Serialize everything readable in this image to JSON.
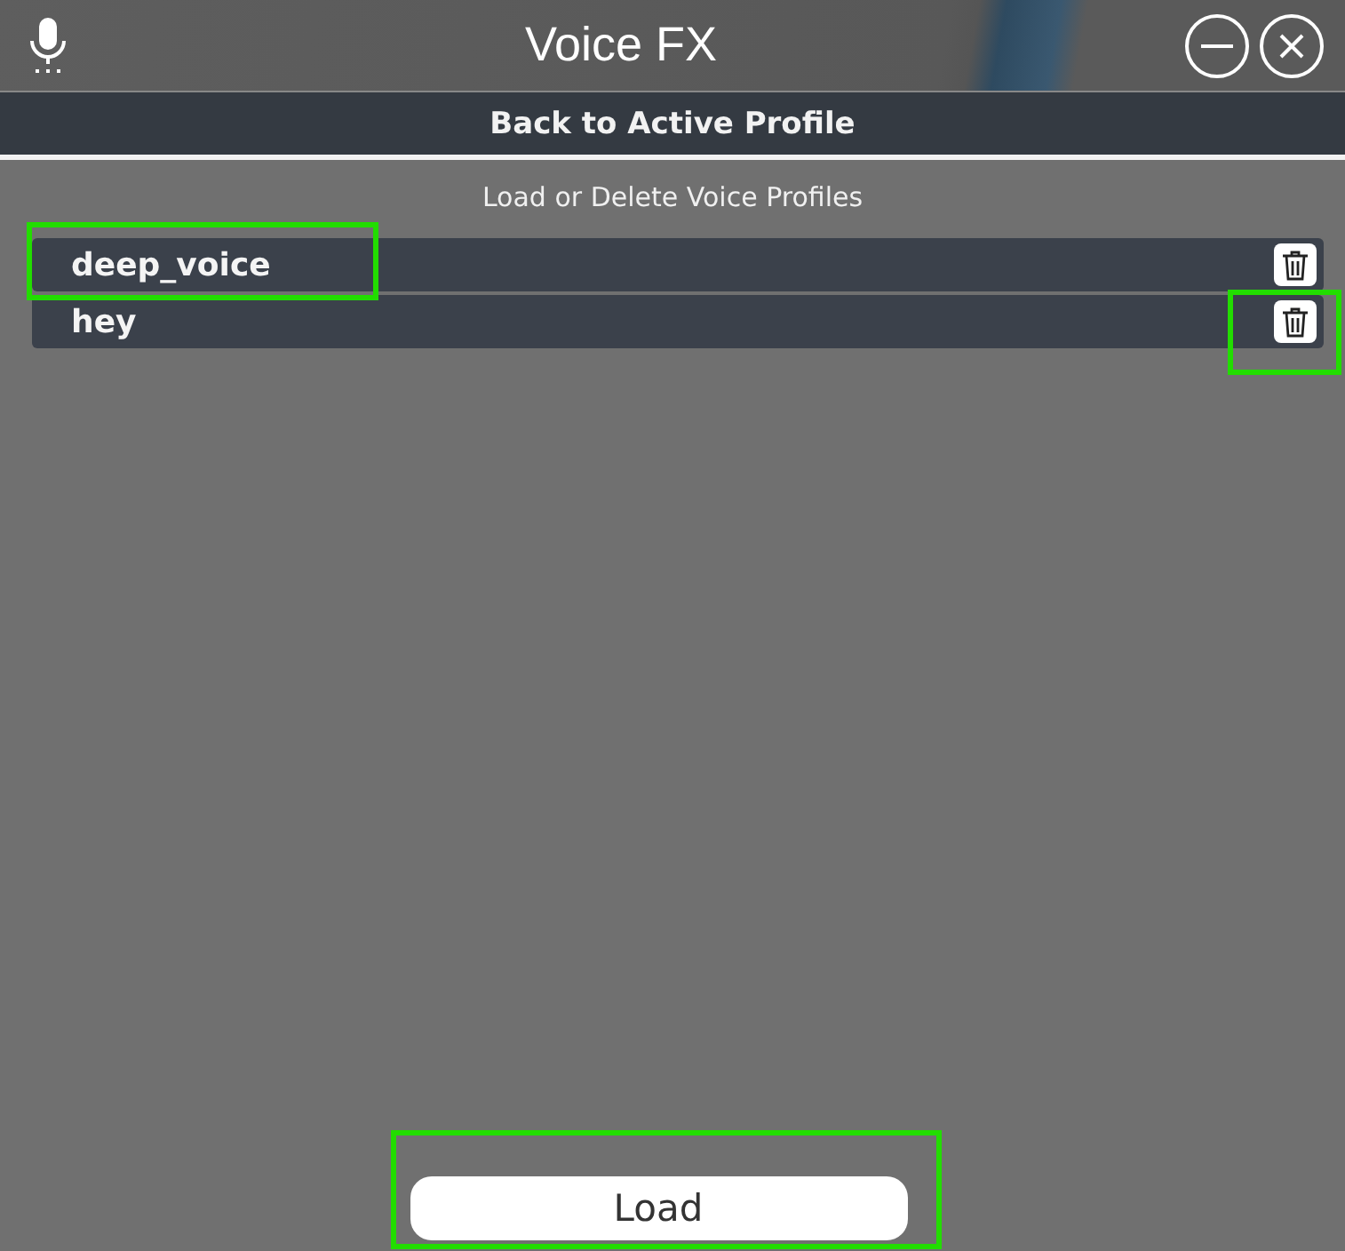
{
  "window": {
    "title": "Voice FX"
  },
  "back_button": {
    "label": "Back to Active Profile"
  },
  "section_title": "Load or Delete Voice Profiles",
  "profiles": [
    {
      "name": "deep_voice",
      "name_highlighted": true,
      "delete_highlighted": false
    },
    {
      "name": "hey",
      "name_highlighted": false,
      "delete_highlighted": true
    }
  ],
  "load_button": {
    "label": "Load",
    "highlighted": true
  }
}
